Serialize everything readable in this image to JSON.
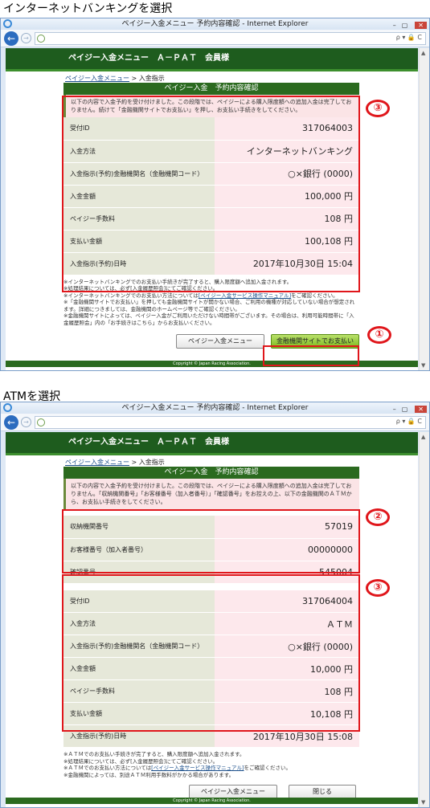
{
  "sections": [
    {
      "heading": "インターネットバンキングを選択"
    },
    {
      "heading": "ATMを選択"
    }
  ],
  "browser": {
    "title": "ペイジー入金メニュー 予約内容確認 - Internet Explorer",
    "address_tools": "ρ ▾ 🔒 C"
  },
  "page": {
    "header": "ペイジー入金メニュー　Ａ－ＰＡＴ　会員様",
    "breadcrumb_link": "ペイジー入金メニュー",
    "breadcrumb_sep": ">",
    "breadcrumb_current": "入金指示",
    "panel_title": "ペイジー入金　予約内容確認",
    "copyright": "Copyright © Japan Racing Association."
  },
  "screen1": {
    "notice": "以下の内容で入金予約を受け付けました。この段階では、ペイジーによる購入限度額への追加入金は完了しておりません。続けて「金融機関サイトでお支払い」を押し、お支払い手続きをしてください。",
    "rows": [
      {
        "key": "受付ID",
        "val": "317064003"
      },
      {
        "key": "入金方法",
        "val": "インターネットバンキング"
      },
      {
        "key": "入金指示(予約)金融機関名（金融機関コード）",
        "val": "○×銀行 (0000)"
      },
      {
        "key": "入金金額",
        "val": "100,000 円"
      },
      {
        "key": "ペイジー手数料",
        "val": "108 円"
      },
      {
        "key": "支払い金額",
        "val": "100,108 円"
      },
      {
        "key": "入金指示(予約)日時",
        "val": "2017年10月30日 15:04"
      }
    ],
    "foot1": "※インターネットバンキングでのお支払い手続きが完了すると、購入限度額へ追加入金されます。",
    "foot2": "※処理結果については、必ず[入金履歴照会]にてご確認ください。",
    "foot3a": "※インターネットバンキングでのお支払い方法については",
    "foot3link": "[ペイジー入金サービス操作マニュアル]",
    "foot3b": "をご確認ください。",
    "foot4": "※「金融機関サイトでお支払い」を押しても金融機関サイトが開かない場合、ご利用の機種が対応していない場合が想定されます。詳細につきましては、金融機関のホームページ等でご確認ください。",
    "foot5": "※金融機関サイトによっては、ペイジー入金がご利用いただけない時間帯がございます。その場合は、利用可能時間帯に「入金履歴照会」内の「お手続きはこちら」からお支払いください。",
    "btn_menu": "ペイジー入金メニュー",
    "btn_pay": "金融機関サイトでお支払い",
    "badge_a": "③",
    "badge_b": "①"
  },
  "screen2": {
    "notice": "以下の内容で入金予約を受け付けました。この段階では、ペイジーによる購入限度額への追加入金は完了しておりません。「収納機関番号」「お客様番号（加入者番号）」「確認番号」をお控えの上、以下の金融機関のＡＴＭから、お支払い手続きをしてください。",
    "rows_top": [
      {
        "key": "収納機関番号",
        "val": "57019"
      },
      {
        "key": "お客様番号（加入者番号）",
        "val": "00000000"
      },
      {
        "key": "確認番号",
        "val": "545004"
      }
    ],
    "rows": [
      {
        "key": "受付ID",
        "val": "317064004"
      },
      {
        "key": "入金方法",
        "val": "ＡＴＭ"
      },
      {
        "key": "入金指示(予約)金融機関名（金融機関コード）",
        "val": "○×銀行 (0000)"
      },
      {
        "key": "入金金額",
        "val": "10,000 円"
      },
      {
        "key": "ペイジー手数料",
        "val": "108 円"
      },
      {
        "key": "支払い金額",
        "val": "10,108 円"
      },
      {
        "key": "入金指示(予約)日時",
        "val": "2017年10月30日 15:08"
      }
    ],
    "foot1": "※ＡＴＭでのお支払い手続きが完了すると、購入限度額へ追加入金されます。",
    "foot2": "※処理結果については、必ず[入金履歴照会]にてご確認ください。",
    "foot3a": "※ＡＴＭでのお支払い方法については",
    "foot3link": "[ペイジー入金サービス操作マニュアル]",
    "foot3b": "をご確認ください。",
    "foot4": "※金融機関によっては、別途ＡＴＭ利用手数料がかかる場合があります。",
    "btn_menu": "ペイジー入金メニュー",
    "btn_close": "閉じる",
    "badge_a": "②",
    "badge_b": "③"
  }
}
